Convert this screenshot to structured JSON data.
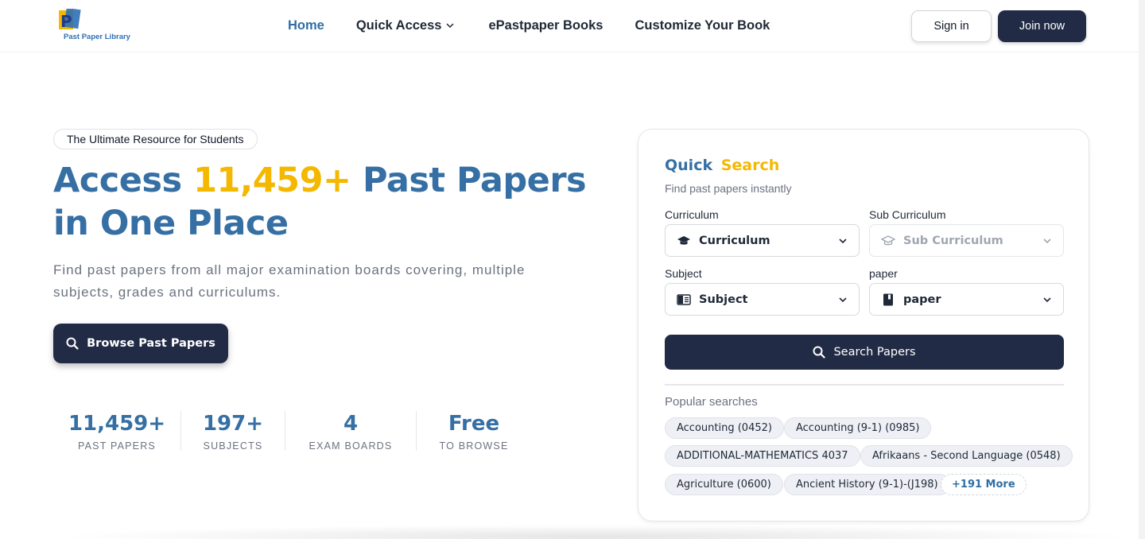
{
  "logo": {
    "text": "Past Paper Library"
  },
  "nav": {
    "links": [
      {
        "label": "Home",
        "active": true
      },
      {
        "label": "Quick Access",
        "dropdown": true
      },
      {
        "label": "ePastpaper Books"
      },
      {
        "label": "Customize Your Book"
      }
    ],
    "sign_in": "Sign in",
    "join": "Join now"
  },
  "hero": {
    "tagline": "The Ultimate Resource for Students",
    "title_pre": "Access ",
    "title_highlight": "11,459+",
    "title_post": " Past Papers in One Place",
    "description": "Find past papers from all major examination boards covering, multiple subjects, grades and curriculums.",
    "browse_button": "Browse Past Papers",
    "stats": [
      {
        "value": "11,459+",
        "label": "PAST PAPERS"
      },
      {
        "value": "197+",
        "label": "SUBJECTS"
      },
      {
        "value": "4",
        "label": "EXAM BOARDS"
      },
      {
        "value": "Free",
        "label": "TO BROWSE"
      }
    ]
  },
  "search": {
    "title_a": "Quick",
    "title_b": "Search",
    "subtitle": "Find past papers instantly",
    "fields": {
      "curriculum": {
        "label": "Curriculum",
        "value": "Curriculum",
        "icon": "graduation-cap-icon"
      },
      "sub_curriculum": {
        "label": "Sub Curriculum",
        "value": "Sub Curriculum",
        "icon": "graduation-cap-icon",
        "disabled": true
      },
      "subject": {
        "label": "Subject",
        "value": "Subject",
        "icon": "book-open-icon"
      },
      "paper": {
        "label": "paper",
        "value": "paper",
        "icon": "book-icon"
      }
    },
    "button": "Search Papers",
    "popular_label": "Popular searches",
    "popular": [
      "Accounting (0452)",
      "Accounting (9-1) (0985)",
      "ADDITIONAL-MATHEMATICS 4037",
      "Afrikaans - Second Language (0548)",
      "Agriculture (0600)",
      "Ancient History (9-1)-(J198)"
    ],
    "more": "+191 More"
  },
  "colors": {
    "primary_blue": "#356fa4",
    "accent_yellow": "#f5b800",
    "dark_navy": "#222b45"
  }
}
